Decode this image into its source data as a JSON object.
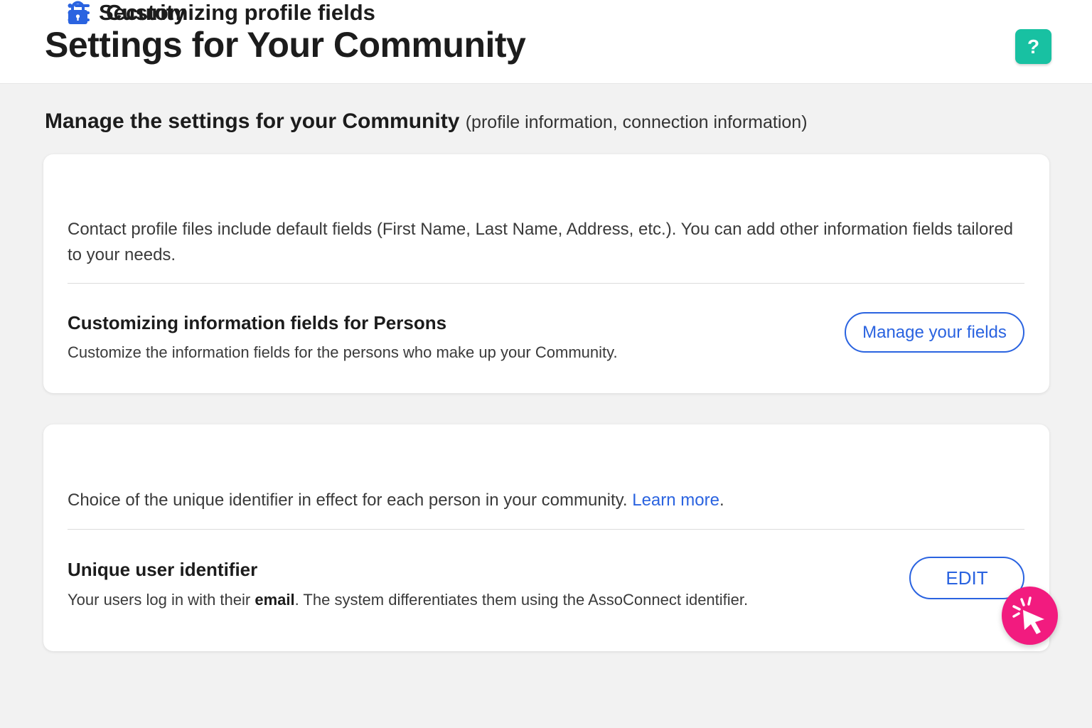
{
  "header": {
    "title": "Settings for Your Community",
    "help_label": "?"
  },
  "intro": {
    "strong": "Manage the settings for your Community",
    "light": "(profile information, connection information)"
  },
  "profile_card": {
    "icon": "list-icon",
    "title": "Customizing profile fields",
    "description": "Contact profile files include default fields (First Name, Last Name, Address, etc.). You can add other information fields tailored to your needs.",
    "sub_title": "Customizing information fields for Persons",
    "sub_description": "Customize the information fields for the persons who make up your Community.",
    "button_label": "Manage your fields"
  },
  "security_card": {
    "icon": "lock-icon",
    "title": "Security",
    "description_before": "Choice of the unique identifier in effect for each person in your community. ",
    "learn_more": "Learn more",
    "description_after": ".",
    "sub_title": "Unique user identifier",
    "sub_description_before": "Your users log in with their ",
    "sub_description_bold": "email",
    "sub_description_after": ". The system differentiates them using the AssoConnect identifier.",
    "button_label": "EDIT"
  },
  "colors": {
    "accent_blue": "#2a63e0",
    "help_green": "#18c1a2",
    "cursor_pink": "#f21b7f",
    "page_bg": "#f2f2f2"
  },
  "overlay": {
    "icon": "click-cursor-icon"
  }
}
